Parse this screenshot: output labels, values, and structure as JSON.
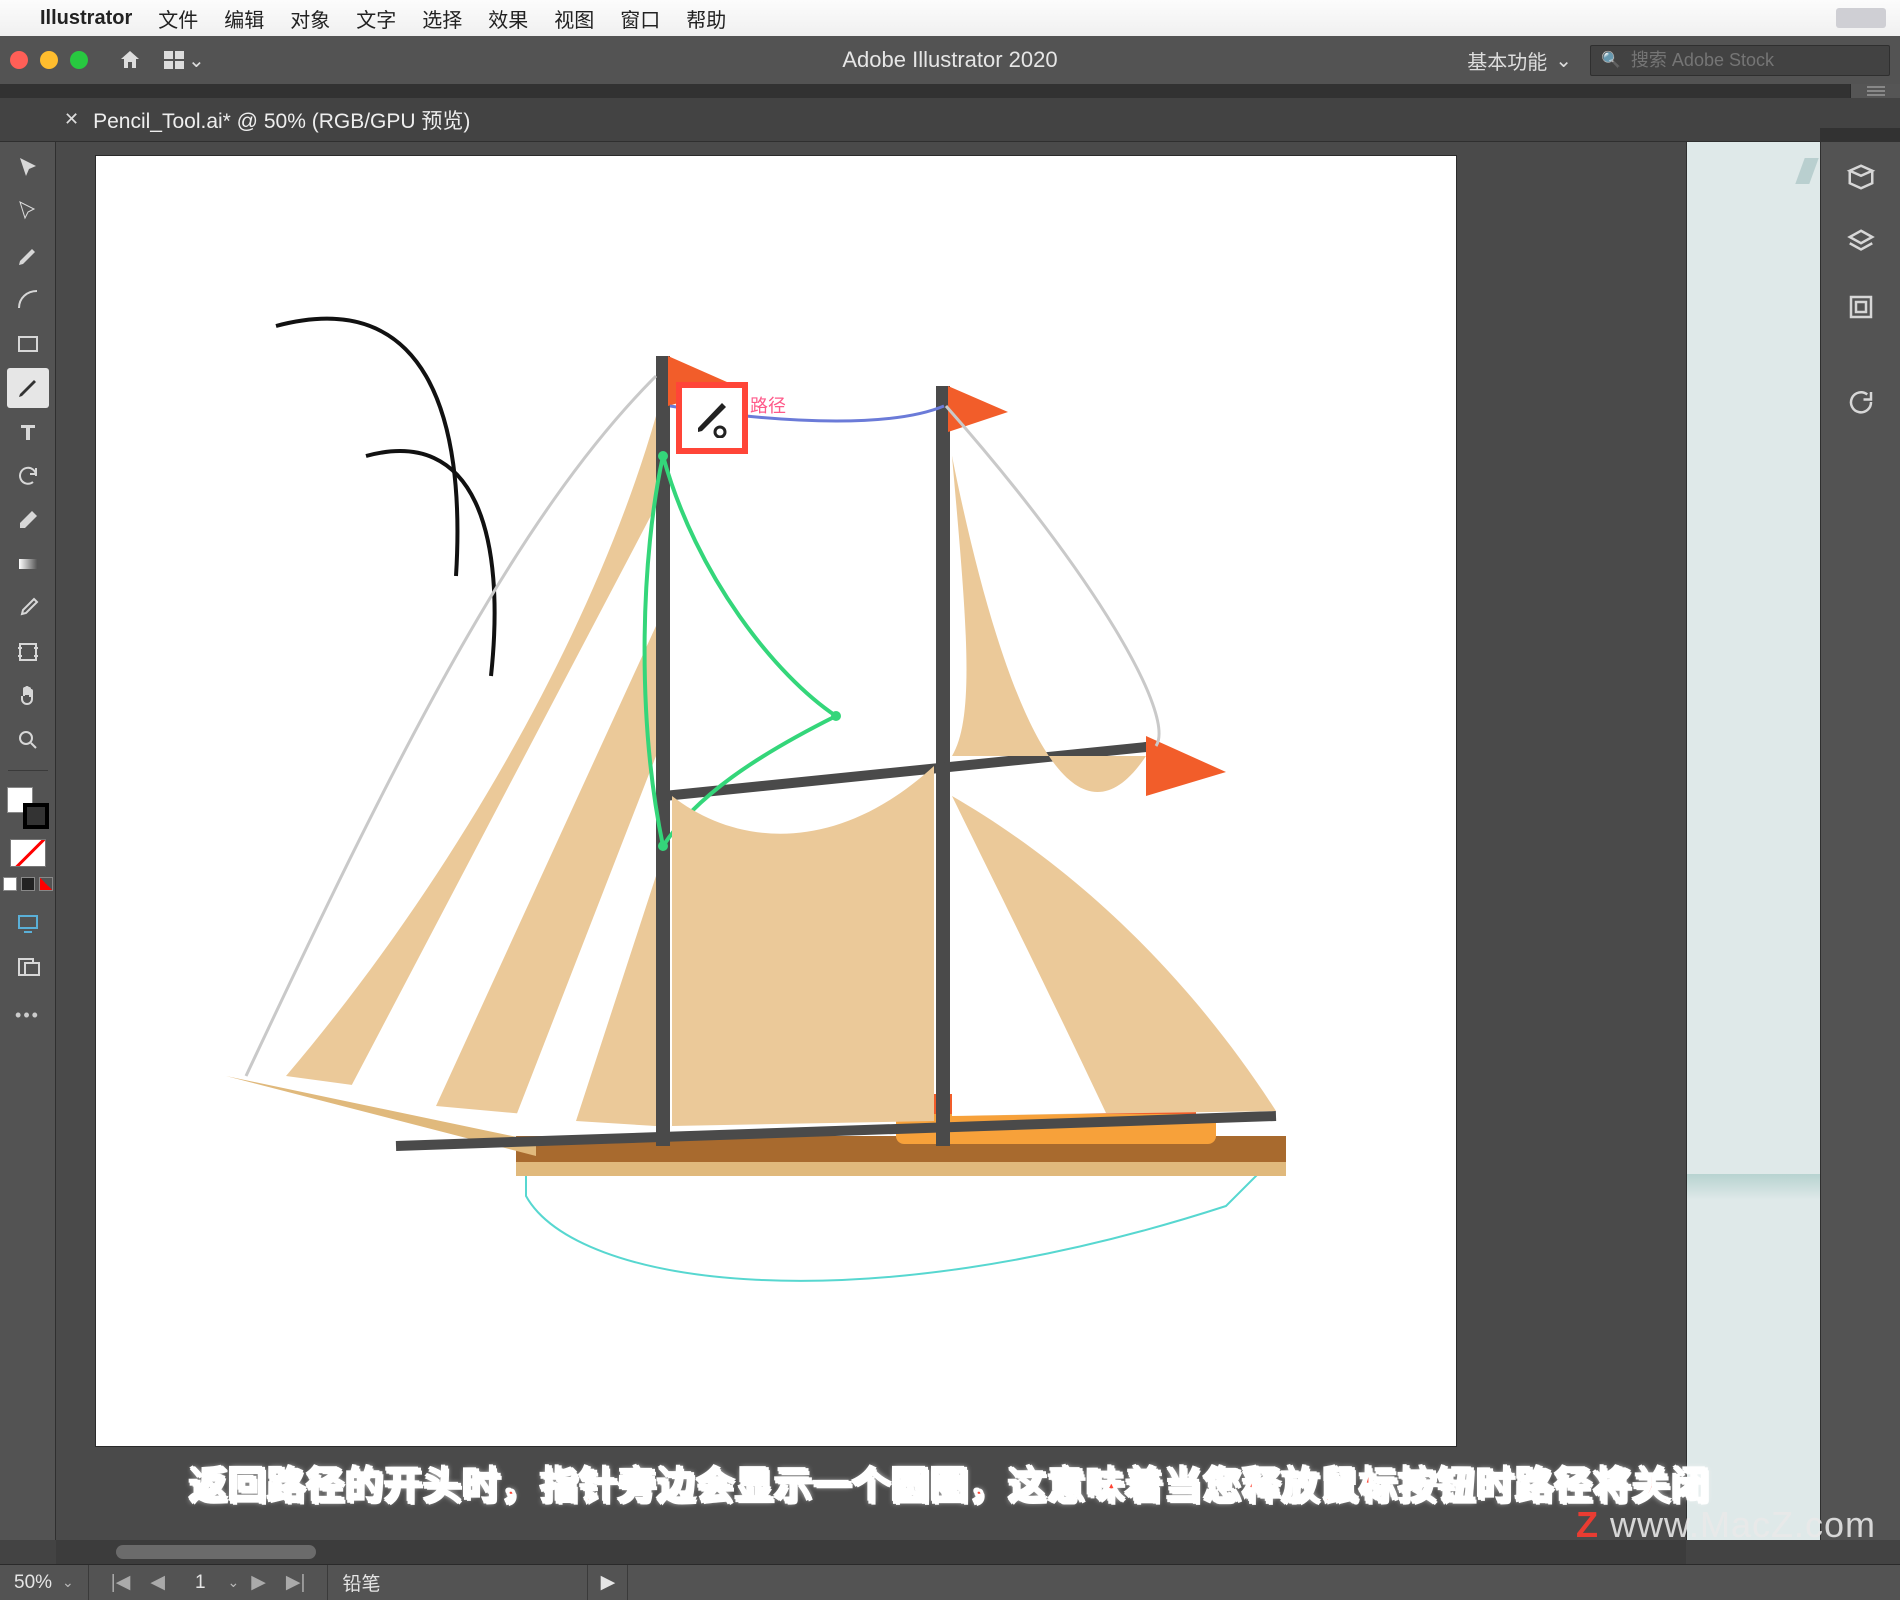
{
  "mac_menu": {
    "app_name": "Illustrator",
    "items": [
      "文件",
      "编辑",
      "对象",
      "文字",
      "选择",
      "效果",
      "视图",
      "窗口",
      "帮助"
    ]
  },
  "title_bar": {
    "title": "Adobe Illustrator 2020",
    "workspace": "基本功能",
    "search_placeholder": "搜索 Adobe Stock"
  },
  "document_tab": {
    "label": "Pencil_Tool.ai* @ 50% (RGB/GPU 预览)"
  },
  "tools": [
    {
      "name": "selection-tool",
      "active": false
    },
    {
      "name": "direct-selection-tool",
      "active": false
    },
    {
      "name": "pen-tool",
      "active": false
    },
    {
      "name": "curvature-tool",
      "active": false
    },
    {
      "name": "rectangle-tool",
      "active": false
    },
    {
      "name": "pencil-tool",
      "active": true
    },
    {
      "name": "type-tool",
      "active": false
    },
    {
      "name": "rotate-tool",
      "active": false
    },
    {
      "name": "eraser-tool",
      "active": false
    },
    {
      "name": "gradient-tool",
      "active": false
    },
    {
      "name": "eyedropper-tool",
      "active": false
    },
    {
      "name": "artboard-tool",
      "active": false
    },
    {
      "name": "hand-tool",
      "active": false
    },
    {
      "name": "zoom-tool",
      "active": false
    }
  ],
  "right_dock": [
    {
      "name": "properties-panel-icon"
    },
    {
      "name": "layers-panel-icon"
    },
    {
      "name": "libraries-panel-icon"
    },
    {
      "name": "refresh-panel-icon"
    }
  ],
  "cursor_annotation": "路径",
  "status": {
    "zoom": "50%",
    "artboard_index": "1",
    "tool_name": "铅笔"
  },
  "caption": "返回路径的开头时，指针旁边会显示一个圆圈，这意味着当您释放鼠标按钮时路径将关闭",
  "watermark": {
    "pre": "",
    "z": "Z",
    "post": " www.MacZ.com"
  },
  "colors": {
    "accent_red": "#ff4538",
    "sail_tan": "#ebc999",
    "flag_orange": "#f25d2a"
  }
}
